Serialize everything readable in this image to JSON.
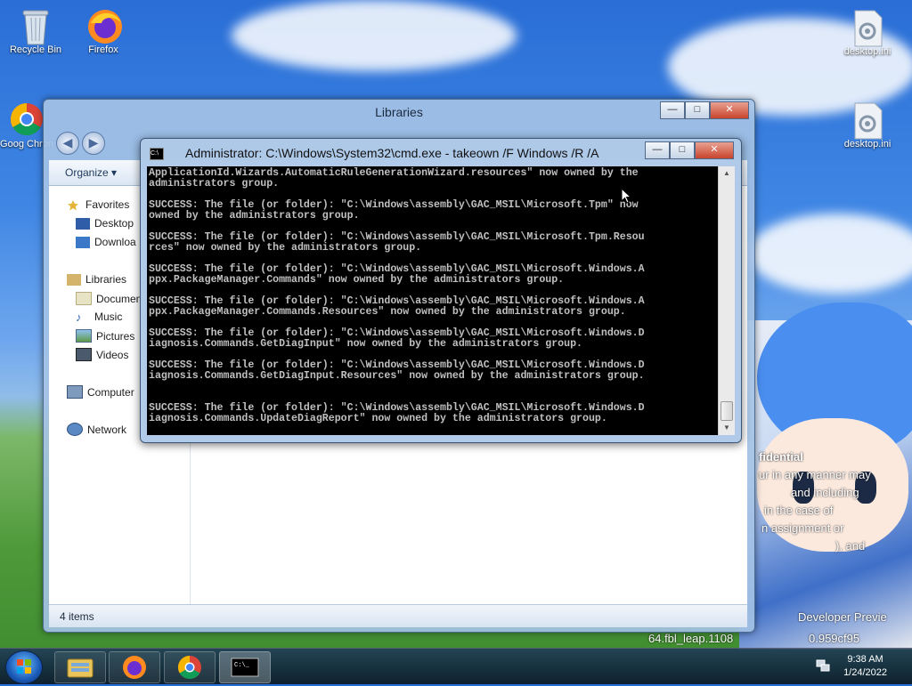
{
  "desktop": {
    "icons": [
      {
        "label": "Recycle Bin",
        "icon": "recycle-bin-icon"
      },
      {
        "label": "Firefox",
        "icon": "firefox-icon"
      },
      {
        "label": "Goog Chron",
        "icon": "chrome-icon"
      },
      {
        "label": "desktop.ini",
        "icon": "settings-file-icon"
      },
      {
        "label": "desktop.ini",
        "icon": "settings-file-icon"
      }
    ],
    "watermark": {
      "line1": "fidential",
      "line2": "ur in any manner may",
      "line3": "and including",
      "line4": "in the case of",
      "line5": "n assignment or",
      "line6": "), and",
      "line7": "Developer Previe",
      "line8": "64.fbl_leap.1108",
      "line9": "0.959cf95"
    }
  },
  "explorer": {
    "title": "Libraries",
    "toolbar": {
      "organize": "Organize ▾"
    },
    "nav_items": {
      "favorites": "Favorites",
      "desktop": "Desktop",
      "downloads": "Downloa",
      "libraries": "Libraries",
      "documents": "Documen",
      "music": "Music",
      "pictures": "Pictures",
      "videos": "Videos",
      "computer": "Computer",
      "network": "Network"
    },
    "status": "4 items"
  },
  "cmd": {
    "title": "Administrator: C:\\Windows\\System32\\cmd.exe - takeown  /F Windows /R /A",
    "output": "ApplicationId.Wizards.AutomaticRuleGenerationWizard.resources\" now owned by the\nadministrators group.\n\nSUCCESS: The file (or folder): \"C:\\Windows\\assembly\\GAC_MSIL\\Microsoft.Tpm\" now\nowned by the administrators group.\n\nSUCCESS: The file (or folder): \"C:\\Windows\\assembly\\GAC_MSIL\\Microsoft.Tpm.Resou\nrces\" now owned by the administrators group.\n\nSUCCESS: The file (or folder): \"C:\\Windows\\assembly\\GAC_MSIL\\Microsoft.Windows.A\nppx.PackageManager.Commands\" now owned by the administrators group.\n\nSUCCESS: The file (or folder): \"C:\\Windows\\assembly\\GAC_MSIL\\Microsoft.Windows.A\nppx.PackageManager.Commands.Resources\" now owned by the administrators group.\n\nSUCCESS: The file (or folder): \"C:\\Windows\\assembly\\GAC_MSIL\\Microsoft.Windows.D\niagnosis.Commands.GetDiagInput\" now owned by the administrators group.\n\nSUCCESS: The file (or folder): \"C:\\Windows\\assembly\\GAC_MSIL\\Microsoft.Windows.D\niagnosis.Commands.GetDiagInput.Resources\" now owned by the administrators group.\n\n\nSUCCESS: The file (or folder): \"C:\\Windows\\assembly\\GAC_MSIL\\Microsoft.Windows.D\niagnosis.Commands.UpdateDiagReport\" now owned by the administrators group."
  },
  "window_buttons": {
    "minimize": "—",
    "maximize": "□",
    "close": "✕"
  },
  "taskbar": {
    "items": [
      "explorer-icon",
      "firefox-icon",
      "chrome-icon",
      "cmd-icon"
    ],
    "time": "9:38 AM",
    "date": "1/24/2022"
  }
}
